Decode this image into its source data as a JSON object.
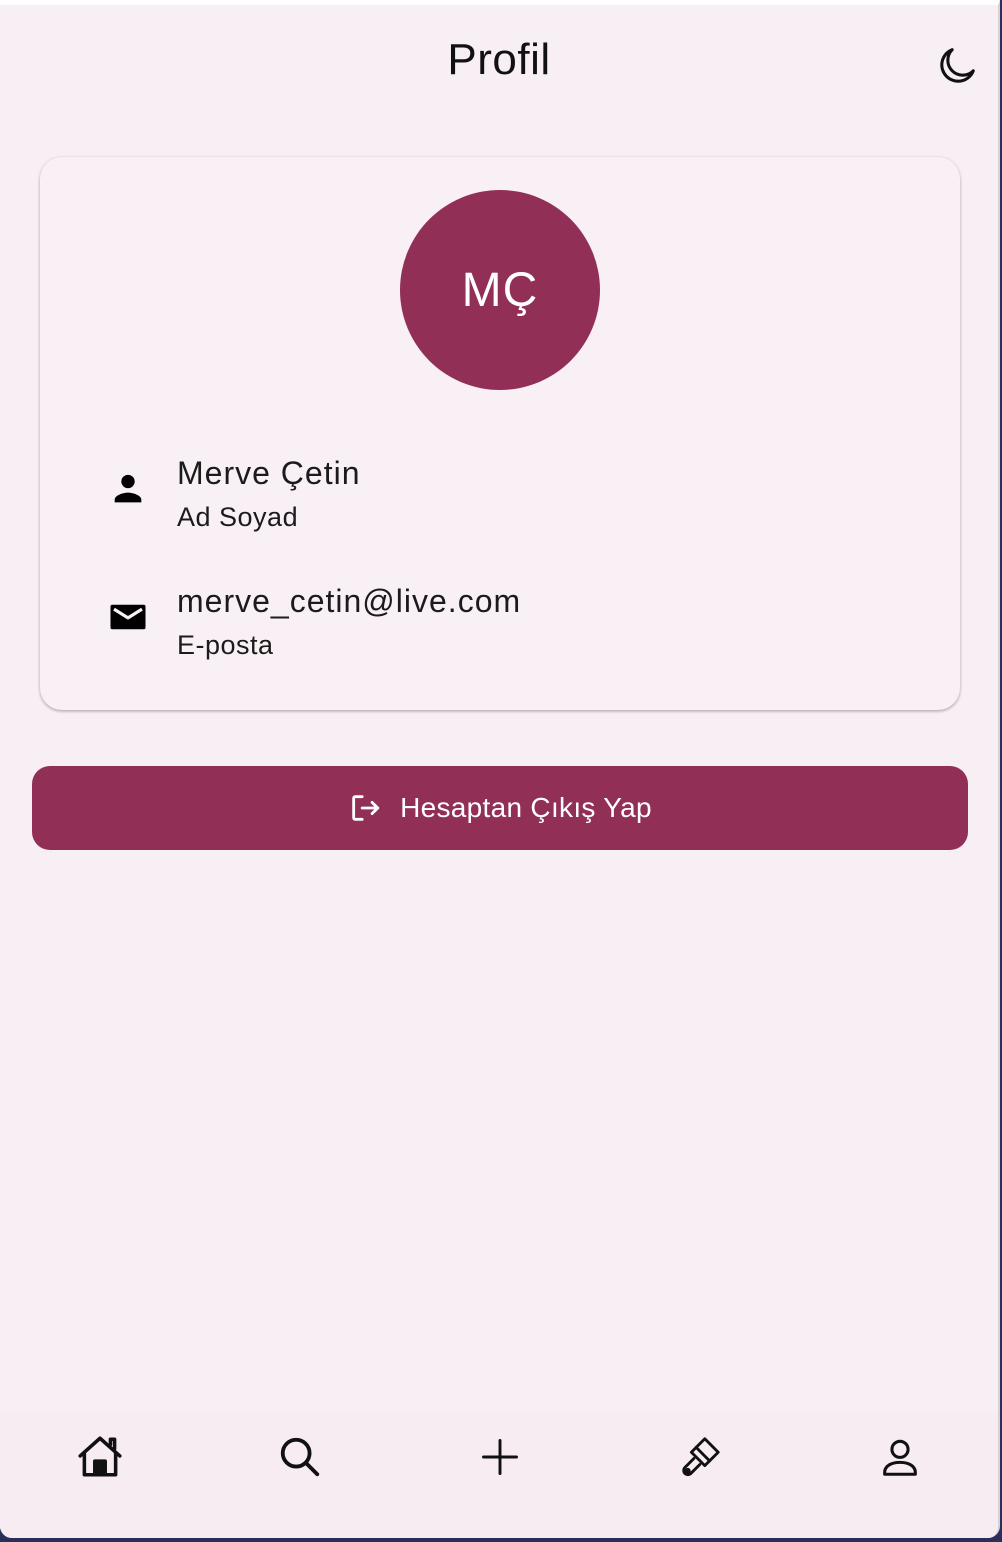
{
  "appbar": {
    "title": "Profil",
    "theme_icon": "moon-icon"
  },
  "profile": {
    "initials": "MÇ",
    "name": "Merve Çetin",
    "name_label": "Ad Soyad",
    "name_icon": "person-icon",
    "email": "merve_cetin@live.com",
    "email_label": "E-posta",
    "email_icon": "mail-icon"
  },
  "logout": {
    "label": "Hesaptan Çıkış Yap",
    "icon": "logout-icon"
  },
  "bottom_nav": {
    "items": [
      {
        "id": "home",
        "icon": "home-icon"
      },
      {
        "id": "search",
        "icon": "search-icon"
      },
      {
        "id": "add",
        "icon": "plus-icon"
      },
      {
        "id": "brush",
        "icon": "brush-icon"
      },
      {
        "id": "profile",
        "icon": "user-icon"
      }
    ]
  },
  "colors": {
    "accent": "#922f57",
    "background": "#f8eff4",
    "text": "#111111"
  }
}
